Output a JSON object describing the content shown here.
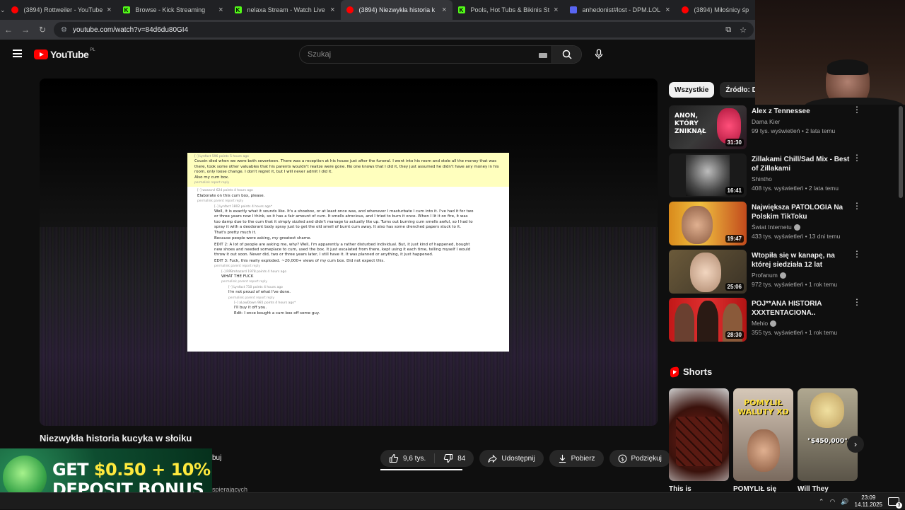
{
  "browser": {
    "tabs": [
      {
        "title": "(3894) Rottweiler - YouTube",
        "icon": "youtube-icon",
        "color": "#ff0000"
      },
      {
        "title": "Browse - Kick Streaming",
        "icon": "kick-icon",
        "color": "#53fc18"
      },
      {
        "title": "nelaxa Stream - Watch Live on",
        "icon": "kick-icon",
        "color": "#53fc18"
      },
      {
        "title": "(3894) Niezwykła historia k",
        "icon": "youtube-icon",
        "color": "#ff0000",
        "active": true
      },
      {
        "title": "Pools, Hot Tubs & Bikinis Strea",
        "icon": "kick-icon",
        "color": "#53fc18"
      },
      {
        "title": "anhedonist#lost - DPM.LOL",
        "icon": "discord-icon",
        "color": "#5865f2"
      },
      {
        "title": "(3894) Miłośnicy śp",
        "icon": "youtube-icon",
        "color": "#ff0000"
      }
    ],
    "url": "youtube.com/watch?v=84d6du80GI4"
  },
  "youtube": {
    "logo_text": "YouTube",
    "country": "PL",
    "search_placeholder": "Szukaj"
  },
  "video": {
    "title": "Niezwykła historia kucyka w słoiku",
    "subscribe_partial": "buj",
    "subs_partial": "spierających",
    "likes": "9,6 tys.",
    "dislikes": "84",
    "share": "Udostępnij",
    "download": "Pobierz",
    "thanks": "Podziękuj",
    "screenshot_text": {
      "u1": "[–] Lynfact  596 points 5 hours ago",
      "p1": "Cousin died when we were both seventeen. There was a reception at his house just after the funeral. I went into his room and stole all the money that was there, took some other valuables that his parents wouldn't realize were gone. No one knows that I did it, they just assumed he didn't have any money in his room, only loose change. I don't regret it, but I will never admit I did it.",
      "p1b": "Also my cum box.",
      "links": "permalink  report  reply",
      "u2": "[–] wasavvl  624 points 4 hours ago",
      "p2": "Elaborate on this cum box, please.",
      "links2": "permalink  parent  report  reply",
      "u3": "[–] Lynfact  1802 points 4 hours ago*",
      "p3": "Well, it is exactly what it sounds like. It's a shoebox, or at least once was, and whenever I masturbate I cum into it. I've had it for two or three years now I think, so it has a fair amount of cum. It smells atrocious, and I tried to burn it once. When I lit it on fire, it was too damp due to the cum that it simply sizzled and didn't manage to actually lite up. Turns out burning cum smells awful, so I had to spray it with a deodorant body spray just to get the old smell of burnt cum away. It also has some drenched papers stuck to it. That's pretty much it.",
      "p3b": "Because people were asking, my greatest shame.",
      "p3c": "EDIT 2: A lot of people are asking me, why? Well, I'm apparently a rather disturbed individual. But, it just kind of happened, bought new shoes and needed someplace to cum, used the box. It just escalated from there, kept using it each time, telling myself I would throw it out soon. Never did, two or three years later, I still have it. It was planned or anything, it just happened.",
      "p3d": "EDIT 3: Fuck, this really exploded. ~20,000+ views of my cum box. Did not expect this.",
      "u4": "[–] RPBmhazard  1978 points 4 hours ago",
      "p4": "WHAT THE FUCK",
      "links4": "permalink  parent  report  reply",
      "u5": "[–] Lynfact  710 points 4 hours ago",
      "p5": "I'm not proud of what I've done.",
      "u6": "[–] aLowDown  981 points 4 hours ago*",
      "p6": "I'll buy it off you.",
      "p6b": "Edit: I once bought a cum box off some guy."
    }
  },
  "ad": {
    "line1_a": "GET ",
    "line1_b": "$0.50 + 10%",
    "line2": "DEPOSIT BONUS"
  },
  "chips": [
    "Wszystkie",
    "Źródło: Dan"
  ],
  "related": [
    {
      "title": "Alex z Tennessee",
      "channel": "Dama Kier",
      "meta": "99 tys. wyświetleń • 2 lata temu",
      "duration": "31:30",
      "verified": false,
      "thumb_text": "ANON, KTÓRY ZNIKNĄŁ"
    },
    {
      "title": "Zillakami Chill/Sad Mix - Best of Zillakami",
      "channel": "Shintho",
      "meta": "408 tys. wyświetleń • 2 lata temu",
      "duration": "16:41",
      "verified": false
    },
    {
      "title": "Największa PATOLOGIA Na Polskim TikToku",
      "channel": "Świat Internetu",
      "meta": "433 tys. wyświetleń • 13 dni temu",
      "duration": "19:47",
      "verified": true
    },
    {
      "title": "Wtopiła się w kanapę, na której siedziała 12 lat",
      "channel": "Profanum",
      "meta": "972 tys. wyświetleń • 1 rok temu",
      "duration": "25:06",
      "verified": true
    },
    {
      "title": "POJ**ANA HISTORIA XXXTENTACIONA..",
      "channel": "Mehio",
      "meta": "355 tys. wyświetleń • 1 rok temu",
      "duration": "28:30",
      "verified": true
    }
  ],
  "shorts": {
    "heading": "Shorts",
    "items": [
      {
        "title": "This is",
        "caption": ""
      },
      {
        "title": "POMYLIŁ się",
        "caption": "POMYLIŁ WALUTY XD"
      },
      {
        "title": "Will They",
        "caption": "\"$450,000\""
      }
    ]
  },
  "taskbar": {
    "time": "23:09",
    "date": "14.11.2025",
    "notifications": "3"
  }
}
